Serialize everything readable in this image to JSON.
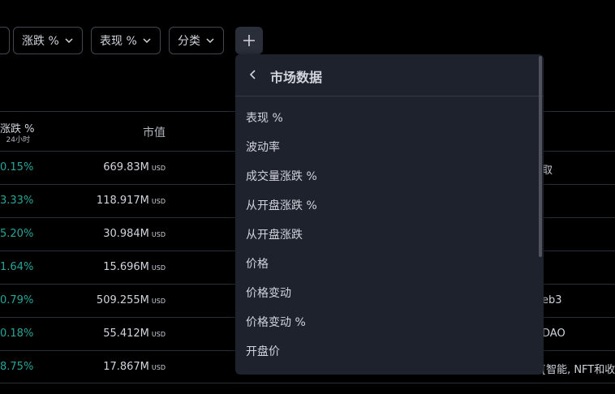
{
  "filters": {
    "change_label": "涨跌 %",
    "performance_label": "表现 %",
    "category_label": "分类"
  },
  "table": {
    "change_header": "涨跌 %",
    "change_subheader": "24小时",
    "mcap_header": "市值",
    "currency": "USD",
    "rows": [
      {
        "change": "0.15%",
        "mcap": "669.83M",
        "category": "取"
      },
      {
        "change": "3.33%",
        "mcap": "118.917M",
        "category": ""
      },
      {
        "change": "5.20%",
        "mcap": "30.984M",
        "category": ""
      },
      {
        "change": "1.64%",
        "mcap": "15.696M",
        "category": ""
      },
      {
        "change": "0.79%",
        "mcap": "509.255M",
        "category": "eb3"
      },
      {
        "change": "0.18%",
        "mcap": "55.412M",
        "category": "DAO"
      },
      {
        "change": "8.75%",
        "mcap": "17.867M",
        "category": "[智能, NFT和收"
      }
    ]
  },
  "dropdown": {
    "title": "市场数据",
    "items": [
      "表现 %",
      "波动率",
      "成交量涨跌 %",
      "从开盘涨跌 %",
      "从开盘涨跌",
      "价格",
      "价格变动",
      "价格变动 %",
      "开盘价"
    ]
  },
  "colors": {
    "positive": "#26a69a",
    "panel_bg": "#1e222d",
    "border": "#434651"
  }
}
